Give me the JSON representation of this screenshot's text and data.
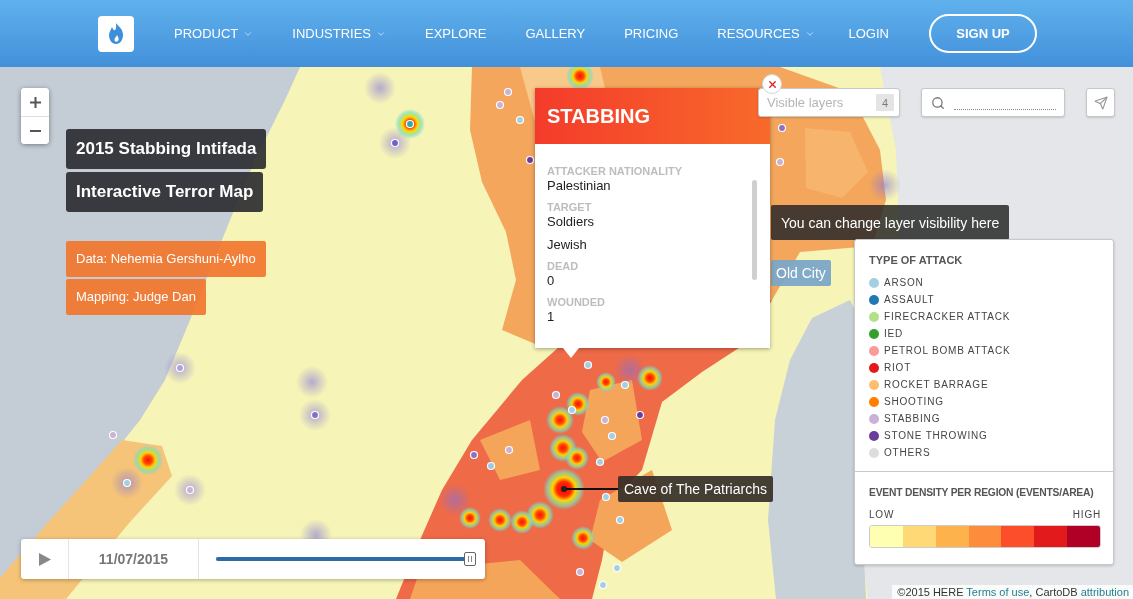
{
  "header": {
    "nav": [
      {
        "label": "PRODUCT",
        "dropdown": true
      },
      {
        "label": "INDUSTRIES",
        "dropdown": true
      },
      {
        "label": "EXPLORE",
        "dropdown": false
      },
      {
        "label": "GALLERY",
        "dropdown": false
      },
      {
        "label": "PRICING",
        "dropdown": false
      },
      {
        "label": "RESOURCES",
        "dropdown": true
      }
    ],
    "login": "LOGIN",
    "signup": "SIGN UP"
  },
  "map_titles": [
    "2015 Stabbing Intifada",
    "Interactive Terror Map"
  ],
  "credits": [
    "Data: Nehemia Gershuni-Aylho",
    "Mapping: Judge Dan"
  ],
  "popup": {
    "title": "STABBING",
    "fields": [
      {
        "label": "ATTACKER NATIONALITY",
        "values": [
          "Palestinian"
        ]
      },
      {
        "label": "TARGET",
        "values": [
          "Soldiers",
          "Jewish"
        ]
      },
      {
        "label": "DEAD",
        "values": [
          "0"
        ]
      },
      {
        "label": "WOUNDED",
        "values": [
          "1"
        ]
      }
    ]
  },
  "layers": {
    "placeholder": "Visible layers",
    "count": "4"
  },
  "hint": "You can change layer visibility here",
  "map_labels": [
    {
      "kind": "place",
      "text": "Old City"
    },
    {
      "kind": "site",
      "text": "Cave of The Patriarchs"
    }
  ],
  "legend": {
    "title": "TYPE OF ATTACK",
    "items": [
      {
        "label": "ARSON",
        "color": "#a6cee3"
      },
      {
        "label": "ASSAULT",
        "color": "#1f78b4"
      },
      {
        "label": "FIRECRACKER ATTACK",
        "color": "#b2df8a"
      },
      {
        "label": "IED",
        "color": "#33a02c"
      },
      {
        "label": "PETROL BOMB ATTACK",
        "color": "#fb9a99"
      },
      {
        "label": "RIOT",
        "color": "#e31a1c"
      },
      {
        "label": "ROCKET BARRAGE",
        "color": "#fdbf6f"
      },
      {
        "label": "SHOOTING",
        "color": "#ff7f00"
      },
      {
        "label": "STABBING",
        "color": "#cab2d6"
      },
      {
        "label": "STONE THROWING",
        "color": "#6a3d9a"
      },
      {
        "label": "OTHERS",
        "color": "#dddddd"
      }
    ],
    "density": {
      "title": "EVENT DENSITY PER REGION (EVENTS/AREA)",
      "low": "LOW",
      "high": "HIGH",
      "steps": [
        {
          "color": "#ffffb2"
        },
        {
          "color": "#fed976"
        },
        {
          "color": "#feb24c"
        },
        {
          "color": "#fd8d3c"
        },
        {
          "color": "#fc4e2a"
        },
        {
          "color": "#e31a1c"
        },
        {
          "color": "#b10026"
        }
      ]
    }
  },
  "timeline": {
    "date": "11/07/2015",
    "level": 0.98
  },
  "attribution": [
    {
      "kind": "text",
      "text": "©2015 HERE "
    },
    {
      "kind": "link",
      "text": "Terms of use"
    },
    {
      "kind": "text",
      "text": ", CartoDB "
    },
    {
      "kind": "link",
      "text": "attribution"
    }
  ]
}
